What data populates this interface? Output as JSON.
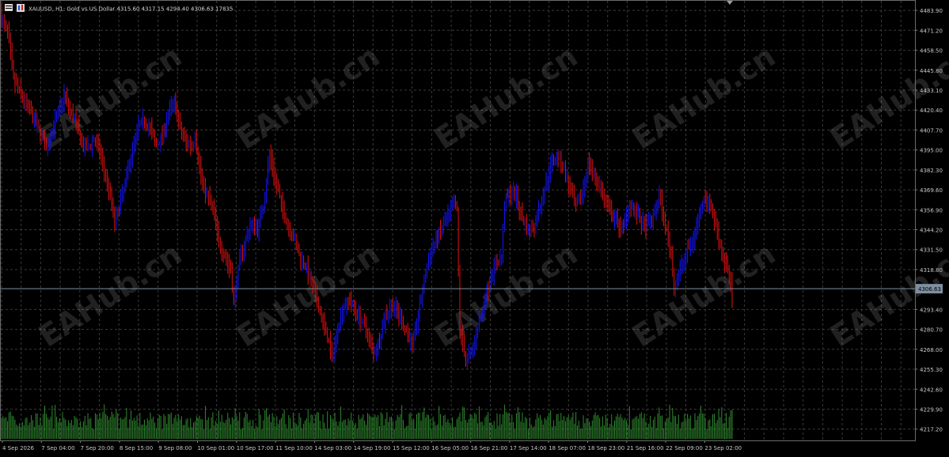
{
  "header": {
    "symbol_line": "XAUUSD, H1:  Gold vs US Dollar  4315.60 4317.15 4294.40 4306.63  17835"
  },
  "watermark": "EAHub.cn",
  "colors": {
    "background": "#000000",
    "grid": "#3a3a3a",
    "bull": "#1414ff",
    "bear": "#e01010",
    "volume": "#2f8a2f",
    "price_line": "#7f8f9f",
    "axis_text": "#c8c8c8",
    "price_tag_bg": "#7f8f9f"
  },
  "chart_data": {
    "type": "candlestick",
    "title": "XAUUSD, H1: Gold vs US Dollar",
    "last_ohlc": {
      "open": 4315.6,
      "high": 4317.15,
      "low": 4294.4,
      "close": 4306.63
    },
    "last_volume": 17835,
    "current_price_label": "4306.63",
    "current_price": 4306.63,
    "y_range": [
      4210.0,
      4490.0
    ],
    "y_ticks": [
      "4483.90",
      "4471.20",
      "4458.50",
      "4445.80",
      "4433.10",
      "4420.40",
      "4407.70",
      "4395.00",
      "4382.30",
      "4369.60",
      "4356.90",
      "4344.20",
      "4331.50",
      "4318.80",
      "4293.40",
      "4280.70",
      "4268.00",
      "4255.30",
      "4242.60",
      "4229.90",
      "4217.20"
    ],
    "x_tick_labels": [
      "4 Sep 2026",
      "7 Sep 04:00",
      "7 Sep 20:00",
      "8 Sep 15:00",
      "9 Sep 08:00",
      "10 Sep 01:00",
      "10 Sep 17:00",
      "11 Sep 10:00",
      "14 Sep 03:00",
      "14 Sep 19:00",
      "15 Sep 12:00",
      "16 Sep 05:00",
      "16 Sep 21:00",
      "17 Sep 14:00",
      "18 Sep 07:00",
      "18 Sep 23:00",
      "21 Sep 16:00",
      "22 Sep 09:00",
      "23 Sep 02:00"
    ],
    "grid": true,
    "close_path": [
      [
        0,
        4478
      ],
      [
        4,
        4470
      ],
      [
        8,
        4440
      ],
      [
        12,
        4432
      ],
      [
        16,
        4425
      ],
      [
        20,
        4418
      ],
      [
        24,
        4410
      ],
      [
        28,
        4402
      ],
      [
        30,
        4395
      ],
      [
        34,
        4408
      ],
      [
        38,
        4418
      ],
      [
        42,
        4430
      ],
      [
        46,
        4420
      ],
      [
        50,
        4412
      ],
      [
        54,
        4398
      ],
      [
        58,
        4396
      ],
      [
        62,
        4402
      ],
      [
        66,
        4394
      ],
      [
        70,
        4378
      ],
      [
        74,
        4362
      ],
      [
        76,
        4348
      ],
      [
        80,
        4362
      ],
      [
        84,
        4378
      ],
      [
        88,
        4396
      ],
      [
        92,
        4410
      ],
      [
        96,
        4414
      ],
      [
        100,
        4408
      ],
      [
        104,
        4398
      ],
      [
        108,
        4404
      ],
      [
        112,
        4418
      ],
      [
        116,
        4426
      ],
      [
        120,
        4408
      ],
      [
        124,
        4400
      ],
      [
        128,
        4398
      ],
      [
        130,
        4404
      ],
      [
        134,
        4378
      ],
      [
        138,
        4366
      ],
      [
        142,
        4358
      ],
      [
        146,
        4336
      ],
      [
        150,
        4328
      ],
      [
        154,
        4318
      ],
      [
        156,
        4298
      ],
      [
        160,
        4325
      ],
      [
        164,
        4338
      ],
      [
        168,
        4348
      ],
      [
        172,
        4345
      ],
      [
        176,
        4360
      ],
      [
        180,
        4392
      ],
      [
        184,
        4376
      ],
      [
        188,
        4360
      ],
      [
        192,
        4348
      ],
      [
        196,
        4340
      ],
      [
        200,
        4328
      ],
      [
        204,
        4322
      ],
      [
        208,
        4310
      ],
      [
        212,
        4298
      ],
      [
        216,
        4285
      ],
      [
        220,
        4272
      ],
      [
        222,
        4262
      ],
      [
        226,
        4282
      ],
      [
        230,
        4296
      ],
      [
        234,
        4300
      ],
      [
        238,
        4292
      ],
      [
        242,
        4286
      ],
      [
        246,
        4278
      ],
      [
        250,
        4266
      ],
      [
        254,
        4274
      ],
      [
        258,
        4290
      ],
      [
        262,
        4296
      ],
      [
        266,
        4292
      ],
      [
        270,
        4284
      ],
      [
        274,
        4276
      ],
      [
        276,
        4270
      ],
      [
        280,
        4290
      ],
      [
        284,
        4312
      ],
      [
        288,
        4328
      ],
      [
        292,
        4338
      ],
      [
        296,
        4345
      ],
      [
        300,
        4352
      ],
      [
        304,
        4360
      ],
      [
        306,
        4356
      ],
      [
        308,
        4280
      ],
      [
        312,
        4262
      ],
      [
        316,
        4266
      ],
      [
        320,
        4282
      ],
      [
        324,
        4296
      ],
      [
        328,
        4312
      ],
      [
        332,
        4322
      ],
      [
        336,
        4326
      ],
      [
        338,
        4362
      ],
      [
        342,
        4368
      ],
      [
        346,
        4365
      ],
      [
        350,
        4352
      ],
      [
        354,
        4343
      ],
      [
        358,
        4346
      ],
      [
        362,
        4360
      ],
      [
        366,
        4374
      ],
      [
        370,
        4388
      ],
      [
        374,
        4392
      ],
      [
        378,
        4382
      ],
      [
        382,
        4370
      ],
      [
        386,
        4358
      ],
      [
        390,
        4366
      ],
      [
        394,
        4386
      ],
      [
        398,
        4380
      ],
      [
        402,
        4372
      ],
      [
        406,
        4360
      ],
      [
        410,
        4354
      ],
      [
        414,
        4348
      ],
      [
        418,
        4346
      ],
      [
        422,
        4362
      ],
      [
        426,
        4356
      ],
      [
        430,
        4348
      ],
      [
        434,
        4346
      ],
      [
        438,
        4352
      ],
      [
        442,
        4366
      ],
      [
        446,
        4346
      ],
      [
        450,
        4330
      ],
      [
        452,
        4306
      ],
      [
        456,
        4318
      ],
      [
        460,
        4330
      ],
      [
        464,
        4336
      ],
      [
        468,
        4350
      ],
      [
        472,
        4366
      ],
      [
        476,
        4360
      ],
      [
        480,
        4348
      ],
      [
        484,
        4330
      ],
      [
        488,
        4318
      ],
      [
        491,
        4306.63
      ]
    ],
    "x_range": [
      0,
      491
    ]
  }
}
